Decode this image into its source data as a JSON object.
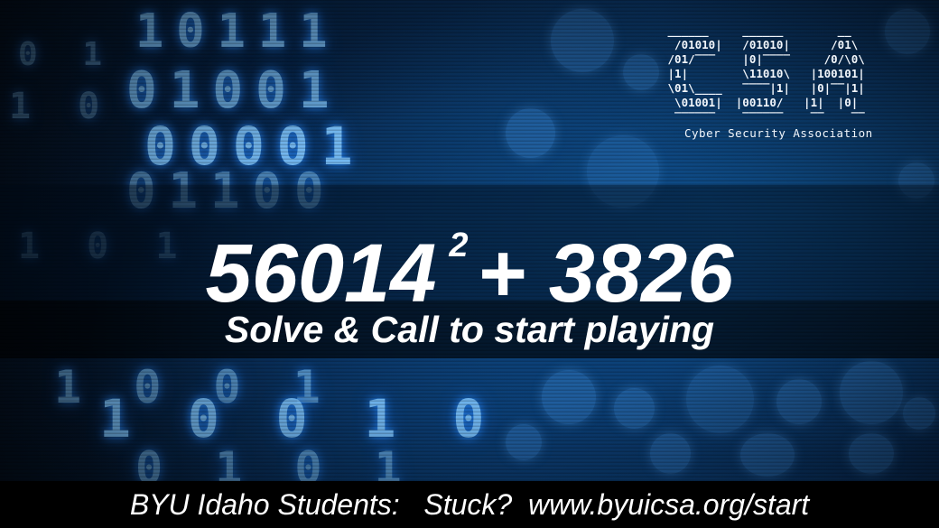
{
  "logo": {
    "ascii_lines": [
      " ______     ______        __ ",
      "  /01010|   /01010|      /01\\",
      " /01/‾‾‾    |0|‾‾‾‾     /0/\\0\\",
      " |1|        \\11010\\   |100101|",
      " \\01\\____   ‾‾‾‾|1|   |0|‾‾|1|",
      "  \\01001|  |00110/   |1|  |0|",
      "  ‾‾‾‾‾‾    ‾‾‾‾‾‾    ‾‾    ‾‾"
    ],
    "caption": "Cyber Security Association"
  },
  "equation": {
    "base": "56014",
    "exponent": "2",
    "rest": "+ 3826"
  },
  "instruction": "Solve & Call to start playing",
  "footer": "BYU Idaho Students:   Stuck?  www.byuicsa.org/start",
  "colors": {
    "background": "#072447",
    "binary_glow": "#7fc6ff",
    "text": "#ffffff",
    "footer_bg": "#000000"
  }
}
